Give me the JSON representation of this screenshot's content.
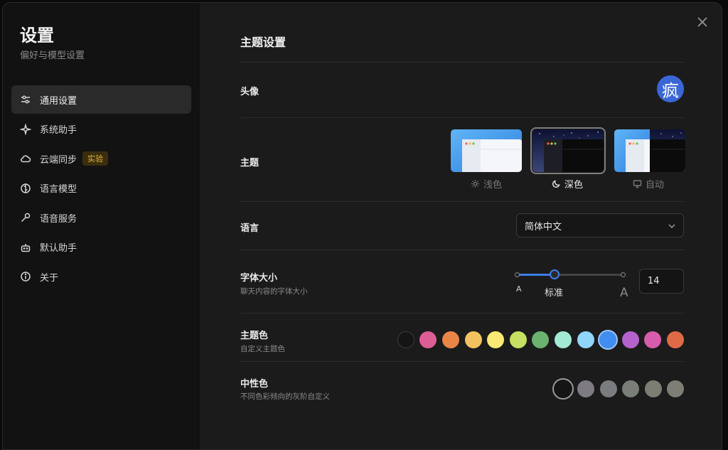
{
  "sidebar": {
    "title": "设置",
    "subtitle": "偏好与模型设置",
    "items": [
      {
        "label": "通用设置",
        "icon": "sliders-icon"
      },
      {
        "label": "系统助手",
        "icon": "sparkle-icon"
      },
      {
        "label": "云端同步",
        "icon": "cloud-icon",
        "badge": "实验"
      },
      {
        "label": "语言模型",
        "icon": "brain-icon"
      },
      {
        "label": "语音服务",
        "icon": "microphone-icon"
      },
      {
        "label": "默认助手",
        "icon": "robot-icon"
      },
      {
        "label": "关于",
        "icon": "info-icon"
      }
    ]
  },
  "main": {
    "title": "主题设置",
    "avatar": {
      "label": "头像",
      "char": "疯"
    },
    "theme": {
      "label": "主题",
      "options": [
        {
          "label": "浅色",
          "icon": "sun-icon"
        },
        {
          "label": "深色",
          "icon": "moon-icon"
        },
        {
          "label": "自动",
          "icon": "monitor-icon"
        }
      ],
      "selected": "深色"
    },
    "language": {
      "label": "语言",
      "value": "简体中文"
    },
    "font": {
      "label": "字体大小",
      "desc": "聊天内容的字体大小",
      "small_mark": "A",
      "mid_mark": "标准",
      "large_mark": "A",
      "value": "14",
      "slider_fraction": 0.35
    },
    "primary_color": {
      "label": "主题色",
      "desc": "自定义主题色",
      "colors": [
        "#151515",
        "#de5d94",
        "#e88547",
        "#f3c260",
        "#f8ea72",
        "#c5e063",
        "#6bb16f",
        "#a3ead4",
        "#8fd6f8",
        "#3f8ef0",
        "#b563cc",
        "#d75cab",
        "#e06a48"
      ],
      "selected_index": 9
    },
    "neutral_color": {
      "label": "中性色",
      "desc": "不同色彩倾向的灰阶自定义",
      "colors": [
        "#151515",
        "#7e7c82",
        "#7a7c80",
        "#7a7e78",
        "#7c7e74",
        "#7e7e76"
      ],
      "selected_index": 0
    }
  },
  "colors": {
    "accent": "#3b7de6",
    "badge_text": "#e3b341",
    "badge_bg": "#3a2e0e"
  }
}
